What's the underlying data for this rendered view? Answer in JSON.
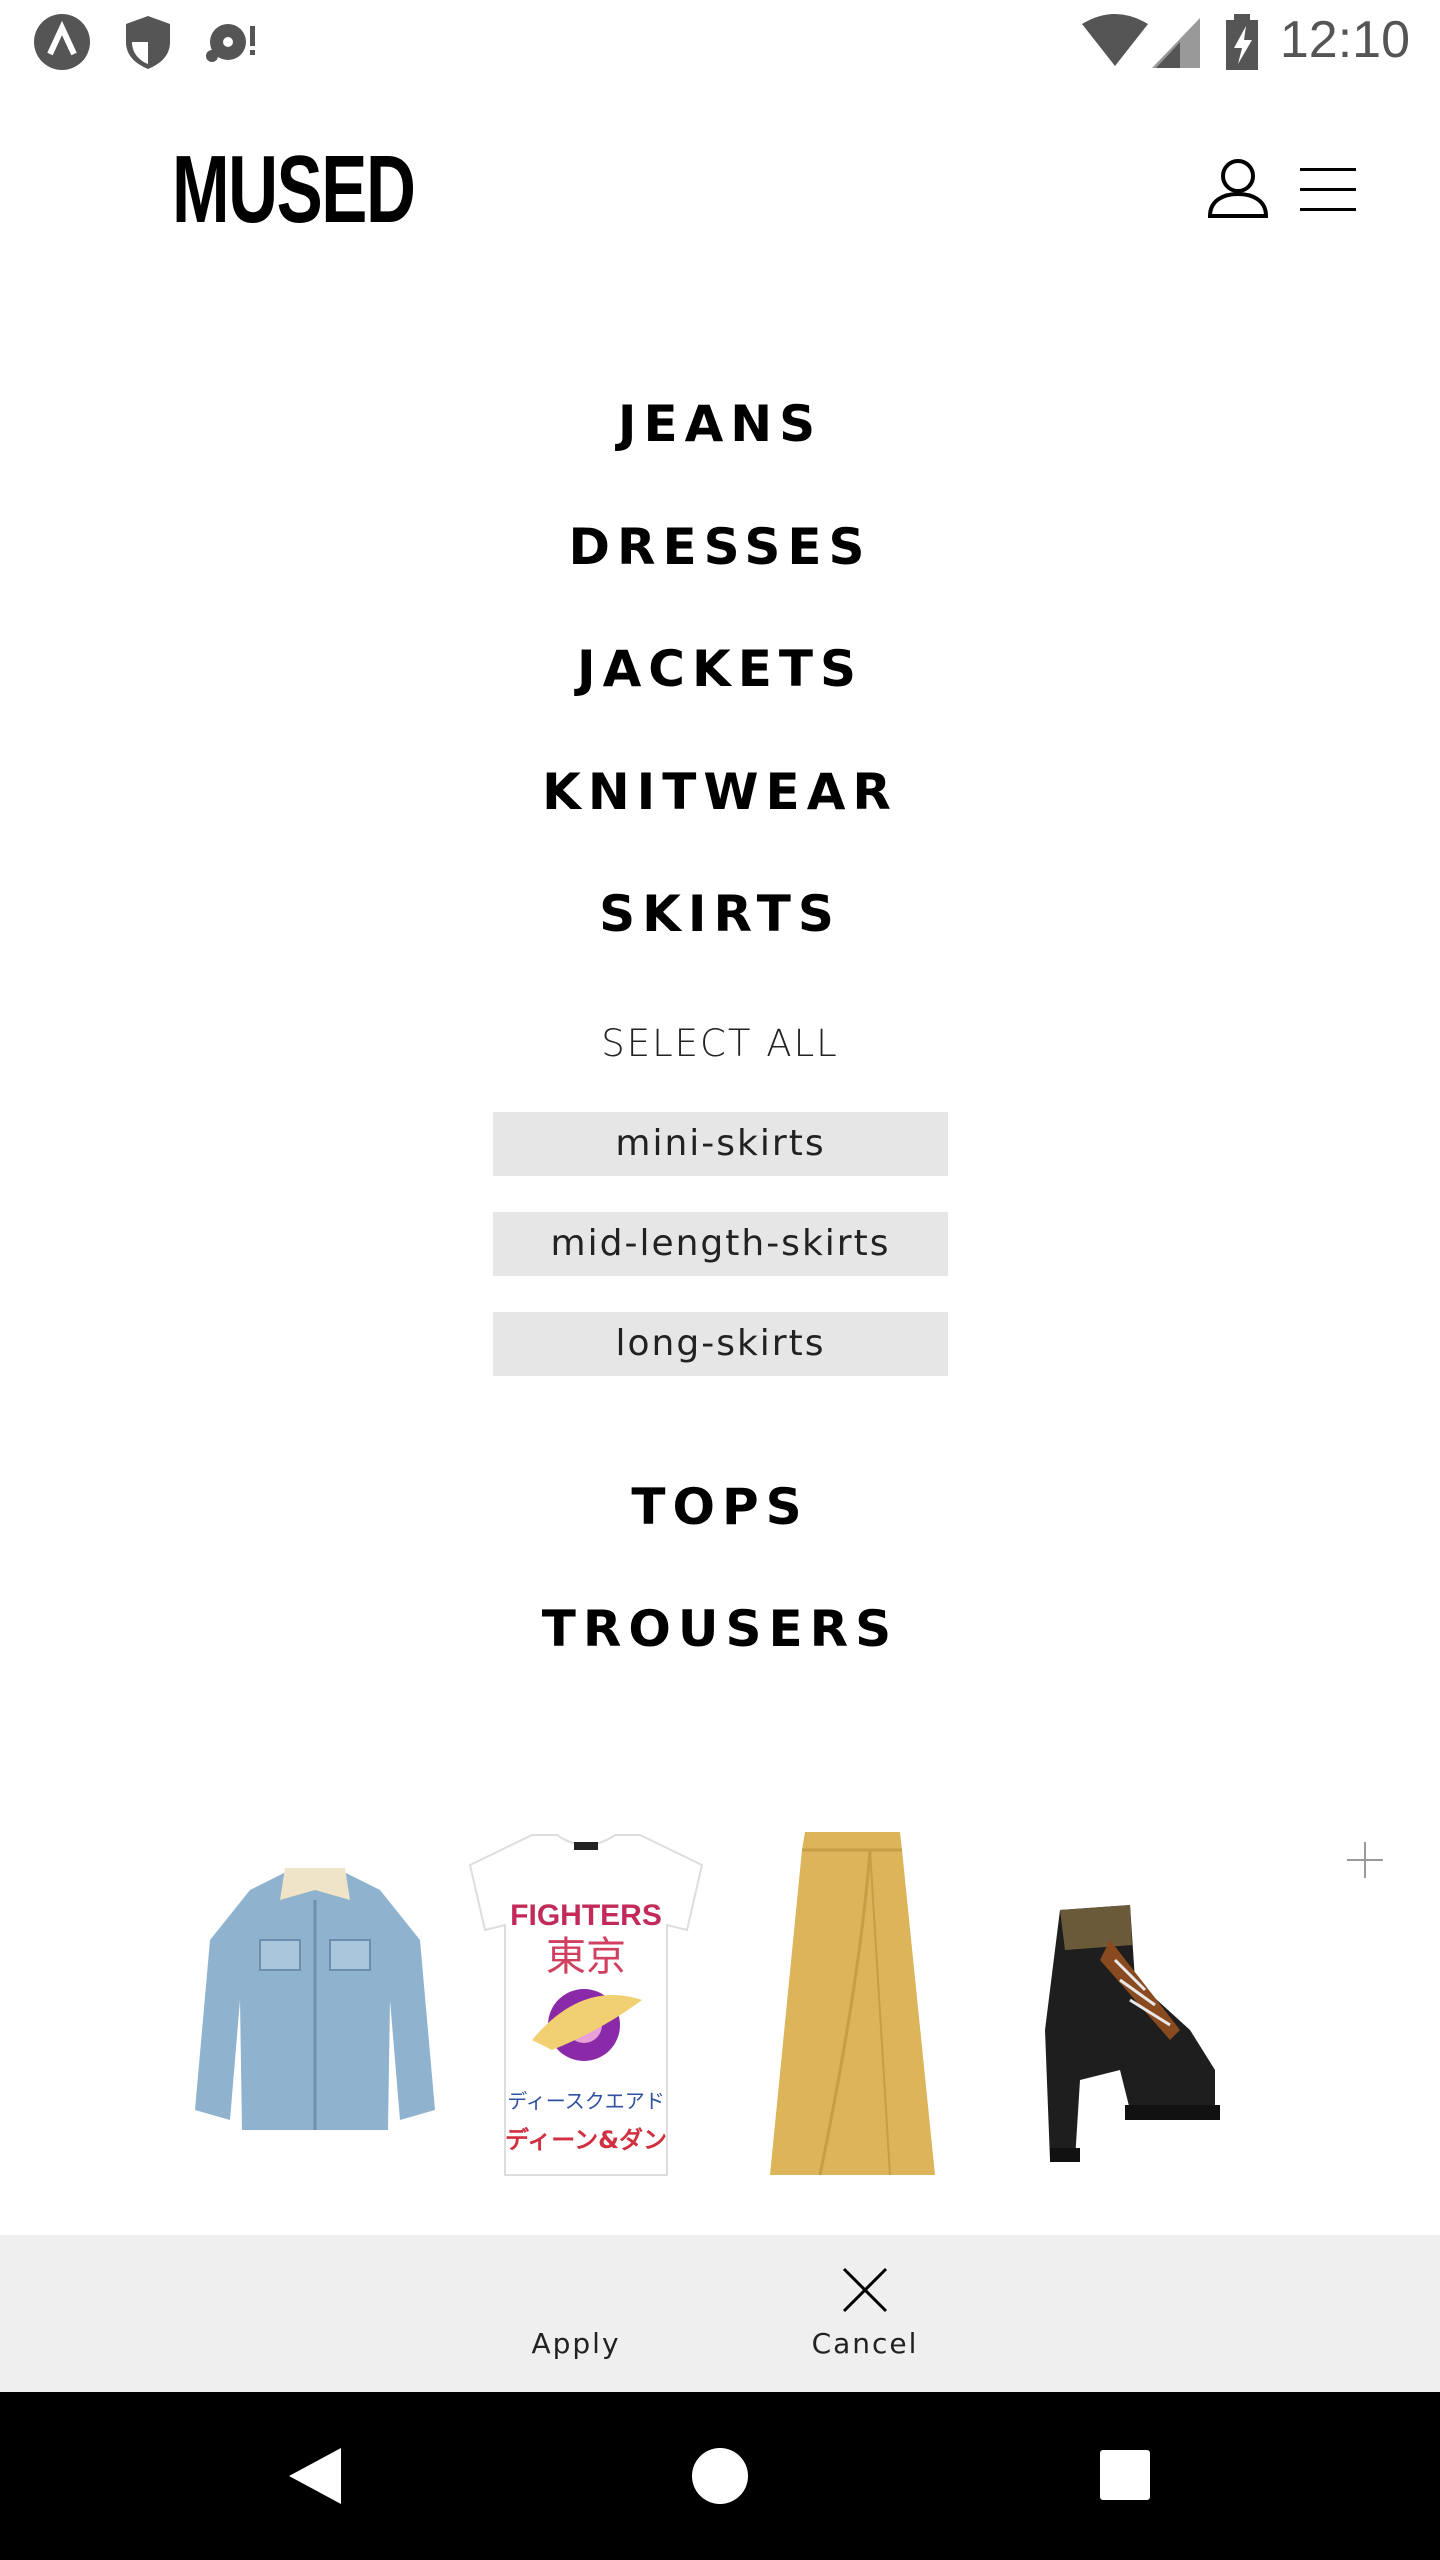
{
  "status_bar": {
    "time": "12:10",
    "icons": [
      "app-a-icon",
      "shield-icon",
      "media-alert-icon",
      "wifi-icon",
      "signal-icon",
      "battery-charging-icon"
    ]
  },
  "header": {
    "logo": "MUSED",
    "icons": [
      "account-icon",
      "menu-icon"
    ]
  },
  "categories": [
    {
      "label": "JEANS"
    },
    {
      "label": "DRESSES"
    },
    {
      "label": "JACKETS"
    },
    {
      "label": "KNITWEAR"
    },
    {
      "label": "SKIRTS"
    },
    {
      "label": "TOPS"
    },
    {
      "label": "TROUSERS"
    }
  ],
  "skirts_filter": {
    "select_all": "SELECT ALL",
    "subcategories": [
      {
        "label": "mini-skirts"
      },
      {
        "label": "mid-length-skirts"
      },
      {
        "label": "long-skirts"
      }
    ]
  },
  "selected_products": {
    "items": [
      {
        "name": "denim-jacket"
      },
      {
        "name": "fighters-tshirt",
        "print_lines": [
          "FIGHTERS",
          "東京",
          "ディースクエアド",
          "ディーン&ダン"
        ]
      },
      {
        "name": "mustard-midi-skirt"
      },
      {
        "name": "lace-up-heeled-boot"
      }
    ],
    "add_icon": "plus-icon"
  },
  "actions": {
    "apply_label": "Apply",
    "cancel_label": "Cancel"
  },
  "nav_bar": {
    "icons": [
      "back-icon",
      "home-icon",
      "recents-icon"
    ]
  },
  "colors": {
    "chip_background": "#e6e6e6",
    "action_bar_background": "#efefef",
    "nav_bar_background": "#000000",
    "skirt_mustard": "#dcb45a"
  }
}
